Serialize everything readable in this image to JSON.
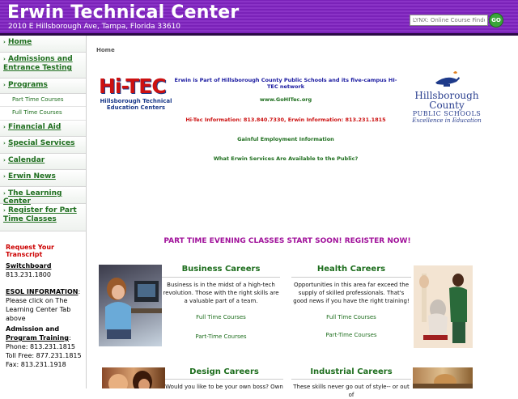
{
  "header": {
    "title": "Erwin Technical Center",
    "address": "2010 E Hillsborough Ave, Tampa, Florida 33610",
    "search_placeholder": "LYNX: Online Course Finder",
    "go_label": "GO"
  },
  "sidebar": {
    "items": [
      {
        "label": "Home"
      },
      {
        "label": "Admissions and Entrance Testing"
      },
      {
        "label": "Programs"
      },
      {
        "label": "Part Time Courses"
      },
      {
        "label": "Full Time Courses"
      },
      {
        "label": "Financial Aid"
      },
      {
        "label": "Special Services"
      },
      {
        "label": "Calendar"
      },
      {
        "label": "Erwin News"
      },
      {
        "label": "The Learning Center"
      },
      {
        "label": "Register for Part Time Classes"
      }
    ],
    "transcript": "Request Your Transcript",
    "switchboard_label": "Switchboard",
    "switchboard_phone": "813.231.1800",
    "esol_label": "ESOL INFORMATION",
    "esol_text": "Please click on The Learning Center Tab above",
    "admission_label": "Admission and",
    "program_training_label": "Program Training",
    "phone_line": "Phone: 813.231.1815",
    "tollfree_line": "Toll Free: 877.231.1815",
    "fax_line": "Fax: 813.231.1918"
  },
  "main": {
    "breadcrumb": "Home",
    "hitec_logo_text": "Hi-TEC",
    "hitec_logo_sub": "Hillsborough Technical Education Centers",
    "hcps_title": "Hillsborough County",
    "hcps_sub": "PUBLIC SCHOOLS",
    "hcps_tag": "Excellence in Education",
    "intro": "Erwin is Part of Hillsborough County Public Schools and its five-campus HI-TEC network",
    "website": "www.GoHITec.org",
    "info_line": "Hi-Tec Information: 813.840.7330, Erwin Information: 813.231.1815",
    "gainful": "Gainful Employment Information",
    "services": "What Erwin Services Are Available to the Public?",
    "promo": "PART TIME EVENING CLASSES START SOON! REGISTER NOW!",
    "cards": [
      {
        "title": "Business Careers",
        "text": "Business is in the midst of a high-tech revolution. Those with the right skills are a valuable part of a team.",
        "link1": "Full Time Courses",
        "link2": "Part-Time Courses"
      },
      {
        "title": "Health Careers",
        "text": "Opportunities in this area far exceed the supply of skilled professionals. That's good news if you have the right training!",
        "link1": "Full Time Courses",
        "link2": "Part-Time Courses"
      },
      {
        "title": "Design Careers",
        "text": "Would you like to be your own boss? Own"
      },
      {
        "title": "Industrial Careers",
        "text": "These skills never go out of style-- or out of"
      }
    ]
  },
  "colors": {
    "header_purple": "#7a22b8",
    "link_green": "#1e6e1e",
    "promo_magenta": "#a0109a",
    "alert_red": "#cc0000",
    "info_red": "#cc1111",
    "intro_blue": "#1a1aa0"
  }
}
